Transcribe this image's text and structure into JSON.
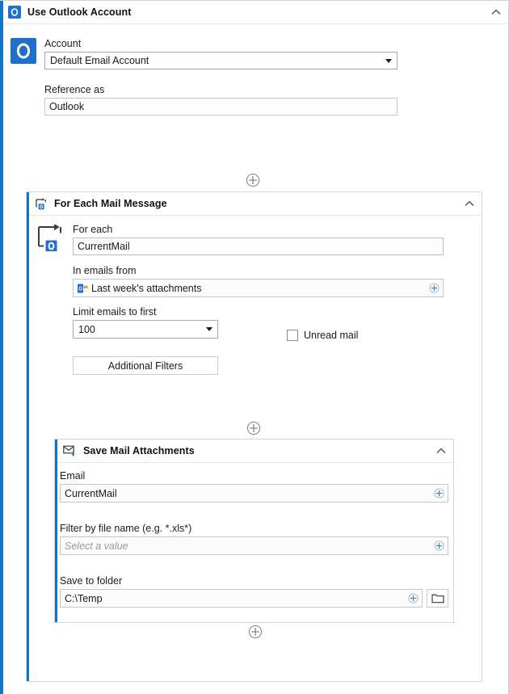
{
  "outlook_account_action": {
    "title": "Use Outlook Account",
    "icon": "outlook-icon",
    "icon_letter": "O",
    "collapse_icon": "chevron-up-icon",
    "account_label": "Account",
    "account_value": "Default Email Account",
    "account_options": [
      "Default Email Account"
    ],
    "reference_label": "Reference as",
    "reference_value": "Outlook"
  },
  "loop_action": {
    "title": "For Each Mail Message",
    "icon": "for-each-loop-icon",
    "badge_letter": "O",
    "collapse_icon": "chevron-up-icon",
    "for_each_label": "For each",
    "for_each_value": "CurrentMail",
    "in_emails_from_label": "In emails from",
    "in_emails_from_value": "Last week's attachments",
    "in_emails_from_icon": "outlook-folder-icon",
    "limit_label": "Limit emails to first",
    "limit_value": "100",
    "limit_options": [
      "100"
    ],
    "unread_label": "Unread mail",
    "unread_checked": false,
    "additional_filters_label": "Additional Filters",
    "insert_variable_icon": "circle-plus-icon"
  },
  "save_attachments_action": {
    "title": "Save Mail Attachments",
    "icon": "mail-download-icon",
    "collapse_icon": "chevron-up-icon",
    "email_label": "Email",
    "email_value": "CurrentMail",
    "filter_label": "Filter by file name (e.g. *.xls*)",
    "filter_value": "",
    "filter_placeholder": "Select a value",
    "folder_label": "Save to folder",
    "folder_value": "C:\\Temp",
    "browse_icon": "folder-icon",
    "insert_variable_icon": "circle-plus-icon"
  },
  "add_buttons": [
    {
      "name": "add-action-after-account",
      "icon": "circle-plus-icon"
    },
    {
      "name": "add-action-inside-loop",
      "icon": "circle-plus-icon"
    },
    {
      "name": "add-action-after-save",
      "icon": "circle-plus-icon"
    }
  ],
  "colors": {
    "accent_blue": "#1275c6",
    "outlook_blue": "#1f6fd0",
    "plus_blue": "#2f7dd1",
    "border_gray": "#d4d4d4",
    "field_border": "#bfbfbf"
  }
}
